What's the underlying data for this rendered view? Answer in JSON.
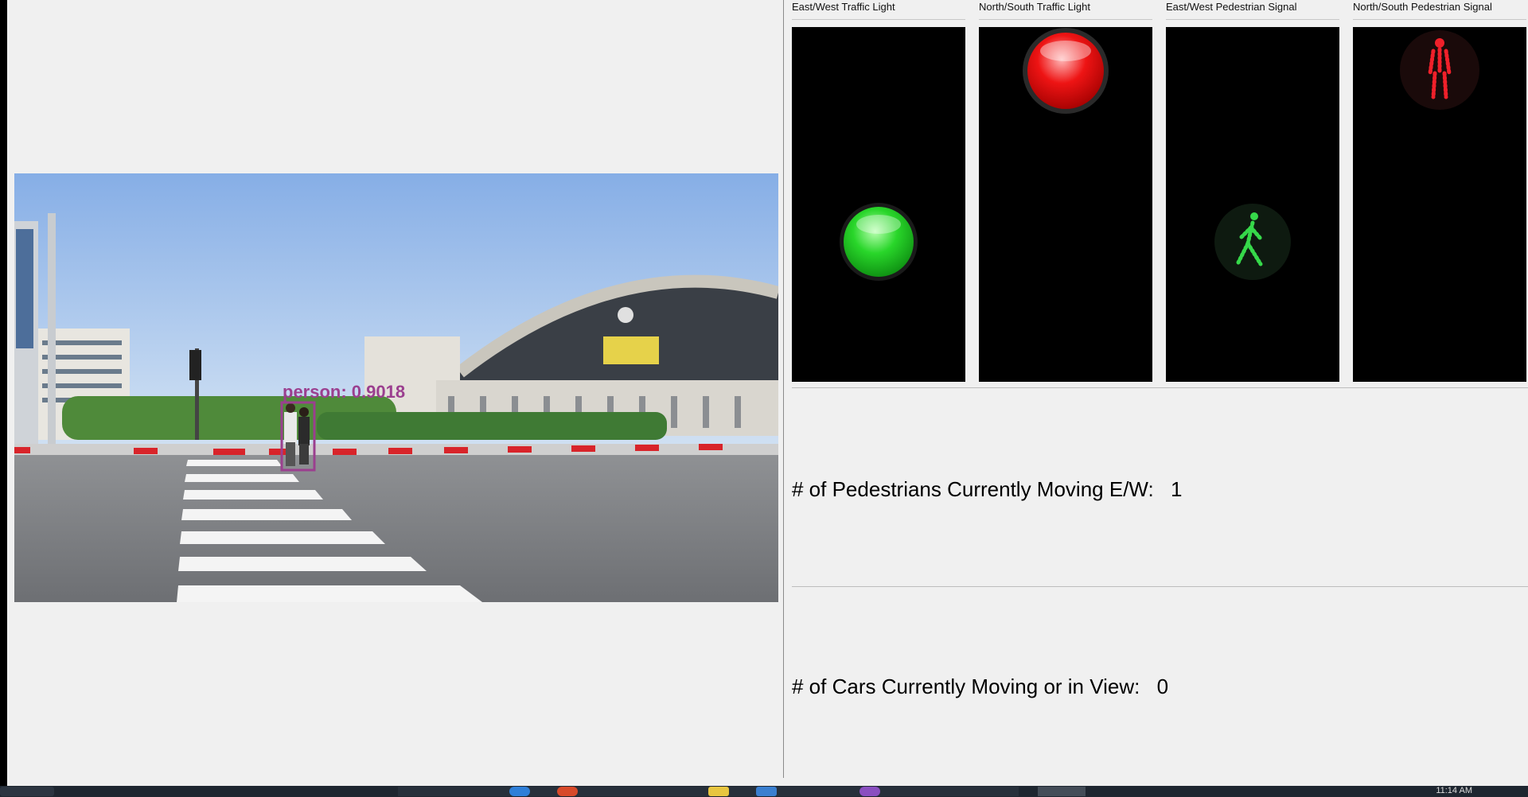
{
  "detection": {
    "label": "person: 0.9018",
    "color": "#9b3f8f"
  },
  "signals": [
    {
      "title": "East/West Traffic Light",
      "kind": "traffic",
      "state": "green",
      "color": "#1fcc1f"
    },
    {
      "title": "North/South Traffic Light",
      "kind": "traffic",
      "state": "red",
      "color": "#e81010"
    },
    {
      "title": "East/West Pedestrian Signal",
      "kind": "pedestrian",
      "state": "walk",
      "color": "#36d84a"
    },
    {
      "title": "North/South Pedestrian Signal",
      "kind": "pedestrian",
      "state": "dont-walk",
      "color": "#f0202a"
    }
  ],
  "stats": {
    "pedestrians_label": "# of Pedestrians Currently Moving E/W:",
    "pedestrians_value": "1",
    "cars_label": "# of Cars Currently Moving or in View:",
    "cars_value": "0"
  },
  "taskbar": {
    "clock": "11:14 AM"
  }
}
